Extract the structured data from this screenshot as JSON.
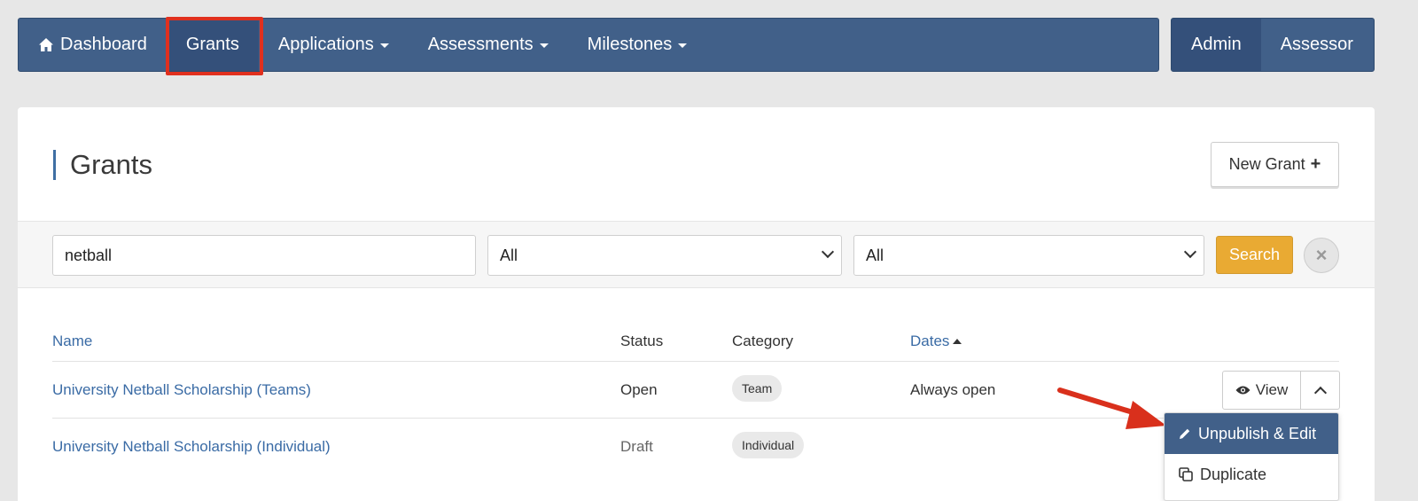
{
  "nav": {
    "items": [
      {
        "label": "Dashboard",
        "icon": "home-icon"
      },
      {
        "label": "Grants"
      },
      {
        "label": "Applications"
      },
      {
        "label": "Assessments"
      },
      {
        "label": "Milestones"
      }
    ],
    "right_items": [
      {
        "label": "Admin"
      },
      {
        "label": "Assessor"
      }
    ]
  },
  "page": {
    "title": "Grants",
    "new_button": "New Grant",
    "new_button_icon": "plus-icon"
  },
  "filters": {
    "search_value": "netball",
    "select_status": "All",
    "select_category": "All",
    "search_button": "Search",
    "clear_icon": "close-icon"
  },
  "table": {
    "headers": {
      "name": "Name",
      "status": "Status",
      "category": "Category",
      "dates": "Dates"
    },
    "rows": [
      {
        "name": "University Netball Scholarship (Teams)",
        "status": "Open",
        "category": "Team",
        "dates": "Always open"
      },
      {
        "name": "University Netball Scholarship (Individual)",
        "status": "Draft",
        "category": "Individual",
        "dates": ""
      }
    ],
    "view_button": "View",
    "view_icon": "eye-icon",
    "toggle_icon": "chevron-up-icon"
  },
  "dropdown": {
    "items": [
      {
        "label": "Unpublish & Edit",
        "icon": "pencil-icon"
      },
      {
        "label": "Duplicate",
        "icon": "copy-icon"
      }
    ]
  },
  "colors": {
    "nav_bg": "#416089",
    "accent_link": "#3a6ba5",
    "search_button": "#e9aa33",
    "highlight": "#e0301e"
  }
}
